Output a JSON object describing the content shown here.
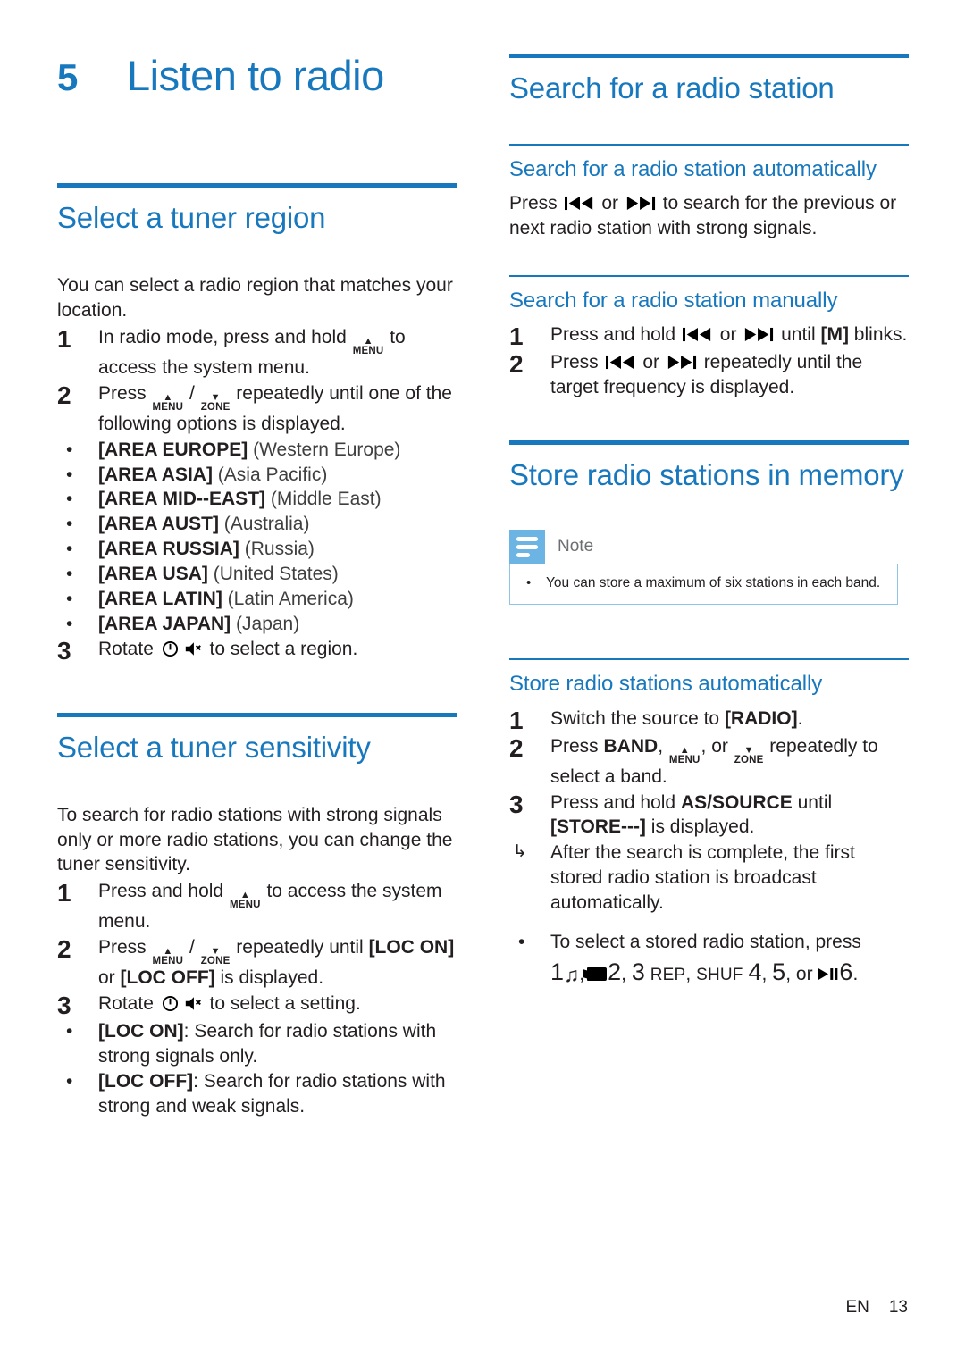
{
  "chapter": {
    "number": "5",
    "title": "Listen to radio"
  },
  "left_column": {
    "section_region": {
      "heading": "Select a tuner region",
      "intro": "You can select a radio region that matches your location.",
      "steps": [
        {
          "num": "1",
          "before": "In radio mode, press and hold ",
          "key": {
            "label": "MENU",
            "arrow": "▲"
          },
          "after": " to access the system menu."
        },
        {
          "num": "2",
          "before": "Press ",
          "key1": {
            "label": "MENU",
            "arrow": "▲"
          },
          "mid": " / ",
          "key2": {
            "label": "ZONE",
            "arrow": "▼"
          },
          "after": " repeatedly until one of the following options is displayed."
        }
      ],
      "options": [
        {
          "code": "[AREA EUROPE]",
          "desc": "(Western Europe)"
        },
        {
          "code": "[AREA ASIA]",
          "desc": "(Asia Pacific)"
        },
        {
          "code": "[AREA MID--EAST]",
          "desc": "(Middle East)"
        },
        {
          "code": "[AREA AUST]",
          "desc": "(Australia)"
        },
        {
          "code": "[AREA RUSSIA]",
          "desc": "(Russia)"
        },
        {
          "code": "[AREA USA]",
          "desc": "(United States)"
        },
        {
          "code": "[AREA LATIN]",
          "desc": "(Latin America)"
        },
        {
          "code": "[AREA JAPAN]",
          "desc": "(Japan)"
        }
      ],
      "step3": {
        "num": "3",
        "before": "Rotate ",
        "icon_power": "⏻",
        "icon_mute": "🔇",
        "after": " to select a region."
      }
    },
    "section_sensitivity": {
      "heading": "Select a tuner sensitivity",
      "intro": "To search for radio stations with strong signals only or more radio stations, you can change the tuner sensitivity.",
      "steps": [
        {
          "num": "1",
          "before": "Press and hold ",
          "key": {
            "label": "MENU",
            "arrow": "▲"
          },
          "after": " to access the system menu."
        },
        {
          "num": "2",
          "before": "Press ",
          "key1": {
            "label": "MENU",
            "arrow": "▲"
          },
          "mid": " / ",
          "key2": {
            "label": "ZONE",
            "arrow": "▼"
          },
          "after_pre": " repeatedly until ",
          "bold1": "[LOC ON]",
          "after_mid": " or ",
          "bold2": "[LOC OFF]",
          "after_end": " is displayed."
        },
        {
          "num": "3",
          "before": "Rotate ",
          "icon_power": "⏻",
          "icon_mute": "🔇",
          "after": " to select a setting."
        }
      ],
      "options": [
        {
          "code": "[LOC ON]",
          "desc": ": Search for radio stations with strong signals only."
        },
        {
          "code": "[LOC OFF]",
          "desc": ": Search for radio stations with strong and weak signals."
        }
      ]
    }
  },
  "right_column": {
    "section_search": {
      "heading": "Search for a radio station",
      "auto": {
        "heading": "Search for a radio station automatically",
        "before": "Press ",
        "icon_prev": "prev-track-icon",
        "mid": " or ",
        "icon_next": "next-track-icon",
        "after": " to search for the previous or next radio station with strong signals."
      },
      "manual": {
        "heading": "Search for a radio station manually",
        "steps": [
          {
            "num": "1",
            "before": "Press and hold ",
            "mid": " or ",
            "after_pre": " until ",
            "bold": "[M]",
            "after_end": " blinks."
          },
          {
            "num": "2",
            "before": "Press ",
            "mid": " or ",
            "after": " repeatedly until the target frequency is displayed."
          }
        ]
      }
    },
    "section_store": {
      "heading": "Store radio stations in memory",
      "note": {
        "title": "Note",
        "items": [
          "You can store a maximum of six stations in each band."
        ]
      },
      "auto": {
        "heading": "Store radio stations automatically",
        "steps": [
          {
            "num": "1",
            "before": "Switch the source to ",
            "bold": "[RADIO]",
            "after": "."
          },
          {
            "num": "2",
            "before": "Press ",
            "bold": "BAND",
            "comma": ", ",
            "key1": {
              "label": "MENU",
              "arrow": "▲"
            },
            "mid": ", or ",
            "key2": {
              "label": "ZONE",
              "arrow": "▼"
            },
            "after": " repeatedly to select a band."
          },
          {
            "num": "3",
            "before": "Press and hold ",
            "bold": "AS/SOURCE",
            "after_pre": " until ",
            "bold2": "[STORE---]",
            "after_end": " is displayed."
          }
        ],
        "result": {
          "arrow": "↳",
          "text": "After the search is complete, the first stored radio station is broadcast automatically."
        },
        "tip": {
          "bullet": "•",
          "text": "To select a stored radio station, press",
          "presets": {
            "p1": "1",
            "icon_music": "♫",
            "sep1": ",",
            "icon_folder": "folder-icon",
            "p2": "2",
            "sep2": ",",
            "p3": "3",
            "rep": "REP",
            "sep3": ",",
            "shuf": "SHUF",
            "p4": "4",
            "sep4": ",",
            "p5": "5",
            "sep5": ",",
            "or": "or",
            "icon_playpause": "▶II",
            "p6": "6",
            "end": "."
          }
        }
      }
    }
  },
  "footer": {
    "language": "EN",
    "page": "13"
  },
  "colors": {
    "accent_blue": "#1878be",
    "note_icon_blue": "#6cb4e4",
    "note_border": "#8ec4e8",
    "text": "#231f20",
    "gray_text": "#3f3f3f"
  }
}
